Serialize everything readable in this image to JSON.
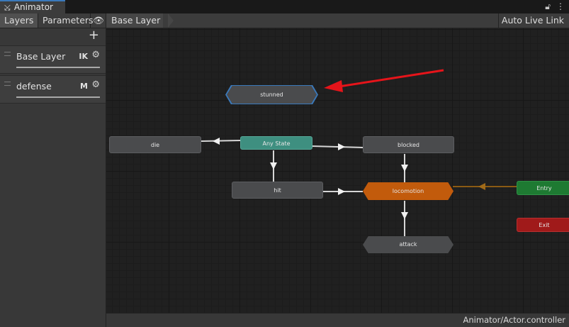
{
  "window": {
    "tab_title": "Animator",
    "icons": [
      "lock-icon",
      "kebab-menu-icon"
    ]
  },
  "toolbar": {
    "layers_label": "Layers",
    "parameters_label": "Parameters",
    "breadcrumb": "Base Layer",
    "auto_live_link_label": "Auto Live Link"
  },
  "sidebar": {
    "add_label": "+",
    "layers": [
      {
        "name": "Base Layer",
        "badge": "IK"
      },
      {
        "name": "defense",
        "badge": "M"
      }
    ]
  },
  "graph": {
    "states": {
      "stunned": "stunned",
      "die": "die",
      "any_state": "Any State",
      "blocked": "blocked",
      "hit": "hit",
      "locomotion": "locomotion",
      "attack": "attack",
      "entry": "Entry",
      "exit": "Exit"
    },
    "colors": {
      "any_state": "#3e8f80",
      "locomotion": "#c25b0c",
      "entry": "#1e7a32",
      "exit": "#a01a1a",
      "selection": "#3a79bb",
      "pointer_arrow": "#e6141a"
    }
  },
  "status": {
    "controller_path": "Animator/Actor.controller"
  }
}
